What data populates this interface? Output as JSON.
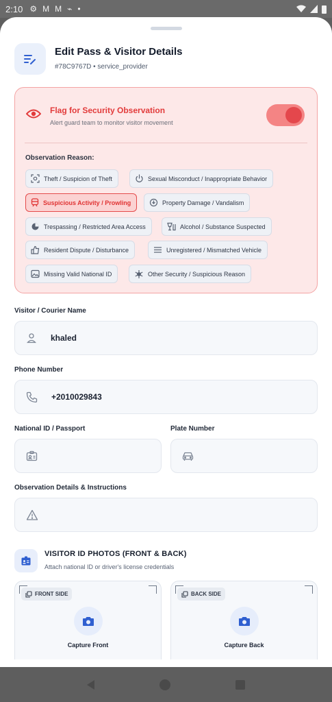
{
  "status_bar": {
    "time": "2:10",
    "icons": [
      "settings-icon",
      "gmail-icon",
      "gmail-icon",
      "cast-icon",
      "dot-icon"
    ],
    "right_icons": [
      "wifi-icon",
      "signal-icon",
      "battery-icon"
    ]
  },
  "header": {
    "title": "Edit Pass & Visitor Details",
    "subtitle": "#78C9767D • service_provider",
    "icon": "edit-list-icon"
  },
  "security": {
    "title": "Flag for Security Observation",
    "subtitle": "Alert guard team to monitor visitor movement",
    "toggle_on": true,
    "reason_label": "Observation Reason:",
    "accent": "#e23b3b",
    "reasons": [
      {
        "label": "Theft / Suspicion of Theft",
        "icon": "scan-face-icon",
        "selected": false
      },
      {
        "label": "Sexual Misconduct / Inappropriate Behavior",
        "icon": "power-icon",
        "selected": false
      },
      {
        "label": "Suspicious Activity / Prowling",
        "icon": "train-icon",
        "selected": true
      },
      {
        "label": "Property Damage / Vandalism",
        "icon": "damage-icon",
        "selected": false
      },
      {
        "label": "Trespassing / Restricted Area Access",
        "icon": "no-entry-icon",
        "selected": false
      },
      {
        "label": "Alcohol / Substance Suspected",
        "icon": "glass-icon",
        "selected": false
      },
      {
        "label": "Resident Dispute / Disturbance",
        "icon": "thumbs-down-icon",
        "selected": false
      },
      {
        "label": "Unregistered / Mismatched Vehicle",
        "icon": "menu-icon",
        "selected": false
      },
      {
        "label": "Missing Valid National ID",
        "icon": "image-icon",
        "selected": false
      },
      {
        "label": "Other Security / Suspicious Reason",
        "icon": "virus-icon",
        "selected": false
      }
    ]
  },
  "form": {
    "visitor_name": {
      "label": "Visitor / Courier Name",
      "value": "khaled",
      "icon": "user-icon"
    },
    "phone": {
      "label": "Phone Number",
      "value": "+2010029843",
      "icon": "phone-icon"
    },
    "national_id": {
      "label": "National ID / Passport",
      "value": "",
      "icon": "id-card-icon"
    },
    "plate": {
      "label": "Plate Number",
      "value": "",
      "icon": "car-icon"
    },
    "observation": {
      "label": "Observation Details & Instructions",
      "value": "",
      "icon": "warning-icon"
    }
  },
  "photos": {
    "title": "VISITOR ID PHOTOS (FRONT & BACK)",
    "subtitle": "Attach national ID or driver's license credentials",
    "front": {
      "badge": "FRONT SIDE",
      "action": "Capture Front"
    },
    "back": {
      "badge": "BACK SIDE",
      "action": "Capture Back"
    }
  }
}
